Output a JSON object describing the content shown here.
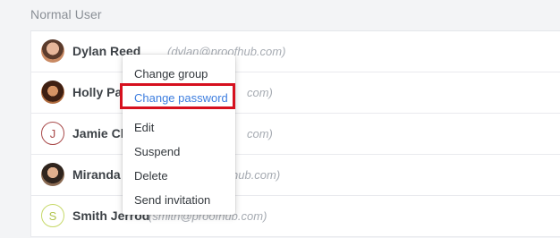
{
  "section": {
    "title": "Normal User"
  },
  "users": [
    {
      "name": "Dylan Reed",
      "email": "(dylan@proofhub.com)",
      "avatar": "photo",
      "avatar_initial": ""
    },
    {
      "name": "Holly Pa",
      "email": "com)",
      "avatar": "photo",
      "avatar_initial": ""
    },
    {
      "name": "Jamie Cla",
      "email": "com)",
      "avatar": "initial",
      "avatar_initial": "J"
    },
    {
      "name": "Miranda",
      "email": "hub.com)",
      "avatar": "photo",
      "avatar_initial": ""
    },
    {
      "name": "Smith Jerrod",
      "email": "(smith@proofhub.com)",
      "avatar": "initial",
      "avatar_initial": "S"
    }
  ],
  "menu": {
    "items": [
      {
        "label": "Change group"
      },
      {
        "label": "Change password",
        "highlighted": true
      },
      {
        "label": "Edit"
      },
      {
        "label": "Suspend"
      },
      {
        "label": "Delete"
      },
      {
        "label": "Send invitation"
      }
    ]
  },
  "colors": {
    "accent": "#3c7ddf",
    "highlight_box": "#d6101e",
    "initial_j": "#a94a4a",
    "initial_s": "#b1c44e"
  }
}
